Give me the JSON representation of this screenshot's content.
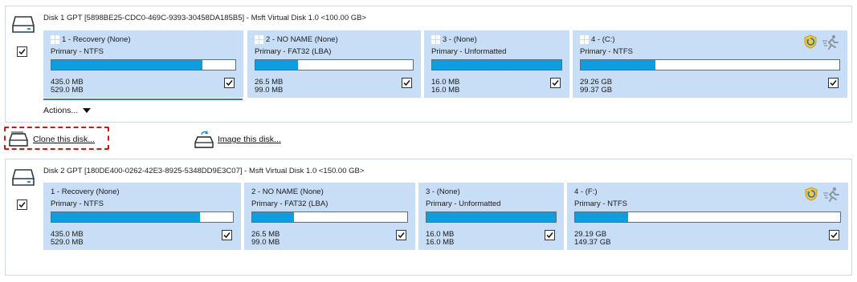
{
  "disk1": {
    "title": "Disk 1 GPT [5898BE25-CDC0-469C-9393-30458DA185B5] - Msft    Virtual Disk    1.0  <100.00 GB>",
    "checked": true,
    "actions_label": "Actions...",
    "partitions": [
      {
        "name": "1 - Recovery (None)",
        "type": "Primary - NTFS",
        "used": "435.0 MB",
        "total": "529.0 MB",
        "usage": 0.82,
        "checked": true,
        "windows_logo": true
      },
      {
        "name": "2 - NO NAME (None)",
        "type": "Primary - FAT32 (LBA)",
        "used": "26.5 MB",
        "total": "99.0 MB",
        "usage": 0.27,
        "checked": true,
        "windows_logo": true
      },
      {
        "name": "3 -  (None)",
        "type": "Primary - Unformatted",
        "used": "16.0 MB",
        "total": "16.0 MB",
        "usage": 1.0,
        "checked": true,
        "windows_logo": true
      },
      {
        "name": "4 -  (C:)",
        "type": "Primary - NTFS",
        "used": "29.26 GB",
        "total": "99.37 GB",
        "usage": 0.29,
        "checked": true,
        "windows_logo": true
      }
    ]
  },
  "toolbar": {
    "clone_label": "Clone this disk...",
    "image_label": "Image this disk..."
  },
  "disk2": {
    "title": "Disk 2 GPT [180DE400-0262-42E3-8925-5348DD9E3C07] - Msft    Virtual Disk    1.0  <150.00 GB>",
    "checked": true,
    "partitions": [
      {
        "name": "1 - Recovery (None)",
        "type": "Primary - NTFS",
        "used": "435.0 MB",
        "total": "529.0 MB",
        "usage": 0.82,
        "checked": true
      },
      {
        "name": "2 - NO NAME (None)",
        "type": "Primary - FAT32 (LBA)",
        "used": "26.5 MB",
        "total": "99.0 MB",
        "usage": 0.27,
        "checked": true
      },
      {
        "name": "3 -  (None)",
        "type": "Primary - Unformatted",
        "used": "16.0 MB",
        "total": "16.0 MB",
        "usage": 1.0,
        "checked": true
      },
      {
        "name": "4 -  (F:)",
        "type": "Primary - NTFS",
        "used": "29.19 GB",
        "total": "149.37 GB",
        "usage": 0.2,
        "checked": true
      }
    ]
  },
  "icons": {
    "disk": "hard-disk-icon",
    "windows": "windows-logo-icon",
    "shield": "shield-sync-icon",
    "runner": "running-man-icon",
    "check": "checkmark-icon"
  },
  "colors": {
    "partition_bg": "#c7def6",
    "usage_fill": "#0e9ee0",
    "highlight_border": "#e01010",
    "selection_underline": "#3a77c8"
  }
}
